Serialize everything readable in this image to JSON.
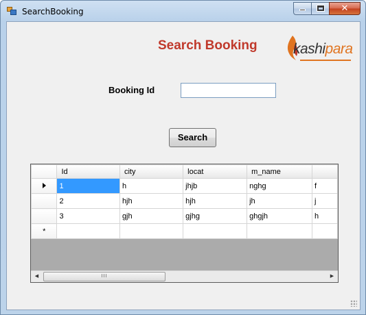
{
  "window": {
    "title": "SearchBooking",
    "minimize_glyph": "",
    "maximize_glyph": "",
    "close_glyph": "✕"
  },
  "heading": "Search Booking",
  "logo": {
    "text_dark": "kashi",
    "text_orange": "para"
  },
  "form": {
    "booking_id_label": "Booking Id",
    "booking_id_value": "",
    "search_button": "Search"
  },
  "grid": {
    "columns": [
      "Id",
      "city",
      "locat",
      "m_name",
      ""
    ],
    "rows": [
      [
        "1",
        "h",
        "jhjb",
        "nghg",
        "f"
      ],
      [
        "2",
        "hjh",
        "hjh",
        "jh",
        "j"
      ],
      [
        "3",
        "gjh",
        "gjhg",
        "ghgjh",
        "h"
      ],
      [
        "",
        "",
        "",
        "",
        ""
      ]
    ],
    "new_row_marker": "*",
    "scroll_thumb_glyph": "III",
    "scroll_left_glyph": "◀",
    "scroll_right_glyph": "▶"
  }
}
